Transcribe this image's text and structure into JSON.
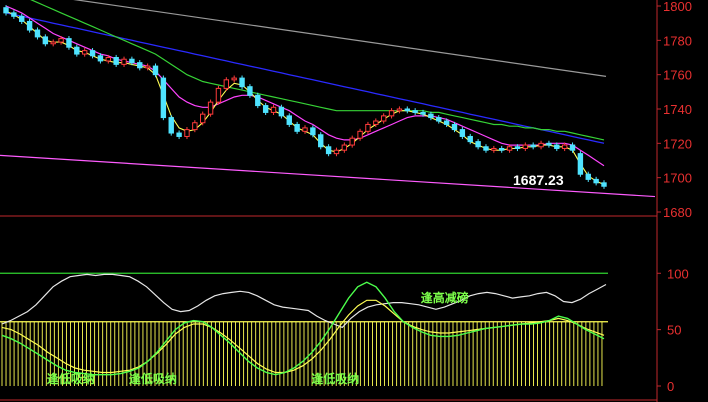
{
  "chart_data": [
    {
      "type": "candlestick",
      "panel": "main",
      "ylim": [
        1680,
        1800
      ],
      "y_ticks": [
        "1800",
        "1780",
        "1760",
        "1740",
        "1720",
        "1700",
        "1680"
      ],
      "last_price_label": "1687.23",
      "colors": {
        "up": "#ff3b3b",
        "down": "#4fe3ff",
        "ma_fast": "#ffff55",
        "ma_mid": "#ff44ff",
        "ma_slow": "#36d236",
        "ma_long": "#2a2aff",
        "trend_upper": "#9a9a9a",
        "trend_lower": "#ff5cff"
      },
      "close": [
        1796,
        1794,
        1791,
        1786,
        1782,
        1778,
        1779,
        1781,
        1776,
        1772,
        1774,
        1771,
        1768,
        1770,
        1766,
        1769,
        1767,
        1764,
        1765,
        1760,
        1735,
        1726,
        1724,
        1728,
        1732,
        1737,
        1744,
        1752,
        1757,
        1758,
        1753,
        1748,
        1742,
        1738,
        1741,
        1736,
        1731,
        1727,
        1729,
        1725,
        1718,
        1714,
        1716,
        1719,
        1723,
        1727,
        1731,
        1733,
        1736,
        1739,
        1740,
        1739,
        1738,
        1737,
        1735,
        1733,
        1731,
        1728,
        1724,
        1721,
        1718,
        1716,
        1717,
        1716,
        1718,
        1717,
        1719,
        1718,
        1720,
        1719,
        1717,
        1719,
        1716,
        1702,
        1699,
        1697,
        1695
      ],
      "open": [
        1799,
        1796,
        1794,
        1791,
        1786,
        1782,
        1778,
        1779,
        1781,
        1776,
        1772,
        1774,
        1771,
        1768,
        1770,
        1766,
        1769,
        1767,
        1764,
        1765,
        1758,
        1735,
        1726,
        1724,
        1728,
        1732,
        1737,
        1744,
        1752,
        1757,
        1758,
        1753,
        1748,
        1742,
        1738,
        1741,
        1736,
        1731,
        1727,
        1729,
        1725,
        1718,
        1714,
        1716,
        1719,
        1723,
        1727,
        1731,
        1733,
        1736,
        1739,
        1740,
        1739,
        1738,
        1737,
        1735,
        1733,
        1731,
        1728,
        1724,
        1721,
        1718,
        1716,
        1717,
        1716,
        1718,
        1717,
        1719,
        1718,
        1720,
        1719,
        1717,
        1719,
        1714,
        1702,
        1699,
        1697
      ],
      "ma_fast": [
        1797,
        1795,
        1792,
        1788,
        1784,
        1780,
        1779,
        1779,
        1777,
        1774,
        1773,
        1771,
        1769,
        1768,
        1767,
        1767,
        1766,
        1765,
        1764,
        1760,
        1748,
        1736,
        1729,
        1727,
        1728,
        1732,
        1738,
        1745,
        1751,
        1755,
        1754,
        1750,
        1745,
        1741,
        1739,
        1737,
        1733,
        1729,
        1727,
        1725,
        1720,
        1716,
        1715,
        1717,
        1720,
        1724,
        1728,
        1731,
        1734,
        1737,
        1739,
        1739,
        1738,
        1737,
        1735,
        1733,
        1731,
        1728,
        1725,
        1721,
        1719,
        1717,
        1716,
        1716,
        1717,
        1717,
        1718,
        1718,
        1719,
        1719,
        1718,
        1718,
        1716,
        1708,
        1701,
        1698,
        1696
      ],
      "ma_mid": [
        1800,
        1798,
        1796,
        1793,
        1790,
        1787,
        1784,
        1782,
        1780,
        1778,
        1776,
        1774,
        1772,
        1771,
        1769,
        1768,
        1767,
        1766,
        1765,
        1762,
        1757,
        1752,
        1747,
        1744,
        1742,
        1741,
        1741,
        1743,
        1745,
        1747,
        1748,
        1748,
        1747,
        1745,
        1743,
        1741,
        1739,
        1736,
        1733,
        1731,
        1728,
        1725,
        1723,
        1722,
        1722,
        1723,
        1725,
        1727,
        1729,
        1731,
        1733,
        1735,
        1736,
        1736,
        1736,
        1735,
        1734,
        1732,
        1730,
        1728,
        1726,
        1724,
        1722,
        1720,
        1719,
        1719,
        1719,
        1719,
        1719,
        1720,
        1720,
        1720,
        1719,
        1716,
        1713,
        1710,
        1707
      ],
      "ma_slow": [
        1810,
        1808,
        1806,
        1804,
        1802,
        1800,
        1798,
        1796,
        1794,
        1792,
        1790,
        1788,
        1786,
        1784,
        1782,
        1780,
        1778,
        1776,
        1774,
        1772,
        1769,
        1766,
        1763,
        1760,
        1758,
        1756,
        1755,
        1754,
        1753,
        1752,
        1751,
        1750,
        1749,
        1748,
        1747,
        1746,
        1745,
        1744,
        1743,
        1742,
        1741,
        1740,
        1739,
        1739,
        1739,
        1739,
        1739,
        1739,
        1739,
        1739,
        1739,
        1739,
        1739,
        1739,
        1738,
        1738,
        1737,
        1736,
        1735,
        1734,
        1733,
        1732,
        1731,
        1731,
        1730,
        1730,
        1729,
        1729,
        1728,
        1728,
        1727,
        1727,
        1726,
        1725,
        1724,
        1723,
        1722
      ],
      "ma_long": [
        1796,
        1795,
        1794,
        1793,
        1792,
        1791,
        1790,
        1789,
        1788,
        1787,
        1786,
        1785,
        1784,
        1783,
        1782,
        1781,
        1780,
        1779,
        1778,
        1777,
        1776,
        1775,
        1774,
        1773,
        1772,
        1771,
        1770,
        1769,
        1768,
        1767,
        1766,
        1765,
        1764,
        1763,
        1762,
        1761,
        1760,
        1759,
        1758,
        1757,
        1756,
        1755,
        1754,
        1753,
        1752,
        1751,
        1750,
        1749,
        1748,
        1747,
        1746,
        1745,
        1744,
        1743,
        1742,
        1741,
        1740,
        1739,
        1738,
        1737,
        1736,
        1735,
        1734,
        1733,
        1732,
        1731,
        1730,
        1729,
        1728,
        1727,
        1726,
        1725,
        1724,
        1723,
        1722,
        1721,
        1720
      ],
      "trend_upper": [
        1810,
        1759
      ],
      "trend_lower": [
        1713,
        1689
      ]
    },
    {
      "type": "indicator",
      "panel": "sub",
      "ylim": [
        0,
        110
      ],
      "y_ticks": [
        "100",
        "50",
        "0"
      ],
      "upper_band": 100,
      "bar_level": 57,
      "signal_labels": [
        {
          "text": "逢低吸纳",
          "x_index": 6,
          "y": 6
        },
        {
          "text": "逢低吸纳",
          "x_index": 15,
          "y": 6
        },
        {
          "text": "逢低吸纳",
          "x_index": 35,
          "y": 6
        },
        {
          "text": "逢高减磅",
          "x_index": 47,
          "y": 78
        }
      ],
      "colors": {
        "line_white": "#e6e6e6",
        "line_green": "#4cff4c",
        "line_yellow": "#ffff55",
        "bars": "#ffff55",
        "band": "#2fd32f"
      },
      "white_line": [
        55,
        58,
        62,
        66,
        72,
        80,
        88,
        93,
        97,
        98,
        99,
        98,
        99,
        99,
        98,
        97,
        93,
        88,
        81,
        74,
        68,
        66,
        67,
        71,
        76,
        80,
        82,
        83,
        84,
        83,
        80,
        76,
        72,
        70,
        69,
        68,
        67,
        62,
        58,
        55,
        52,
        60,
        66,
        70,
        72,
        73,
        74,
        74,
        73,
        72,
        70,
        68,
        70,
        73,
        76,
        80,
        82,
        83,
        82,
        80,
        78,
        79,
        80,
        82,
        83,
        80,
        75,
        74,
        77,
        82,
        86,
        90
      ],
      "green_line": [
        45,
        42,
        38,
        33,
        28,
        23,
        18,
        14,
        12,
        11,
        10,
        10,
        10,
        11,
        13,
        16,
        22,
        30,
        40,
        50,
        56,
        58,
        57,
        52,
        45,
        38,
        30,
        22,
        16,
        12,
        10,
        12,
        16,
        22,
        30,
        40,
        52,
        65,
        78,
        88,
        92,
        88,
        78,
        66,
        57,
        52,
        48,
        45,
        44,
        44,
        45,
        47,
        49,
        51,
        52,
        53,
        54,
        55,
        55,
        56,
        58,
        62,
        60,
        55,
        50,
        46,
        42
      ],
      "yellow_line": [
        52,
        50,
        46,
        41,
        36,
        30,
        25,
        20,
        16,
        14,
        13,
        12,
        12,
        13,
        14,
        17,
        22,
        29,
        37,
        46,
        52,
        55,
        55,
        52,
        47,
        41,
        34,
        27,
        20,
        15,
        12,
        12,
        14,
        18,
        24,
        32,
        42,
        53,
        63,
        71,
        76,
        76,
        71,
        64,
        57,
        53,
        50,
        48,
        47,
        47,
        48,
        49,
        50,
        51,
        52,
        53,
        54,
        55,
        56,
        57,
        58,
        60,
        58,
        55,
        51,
        48,
        45
      ]
    }
  ]
}
